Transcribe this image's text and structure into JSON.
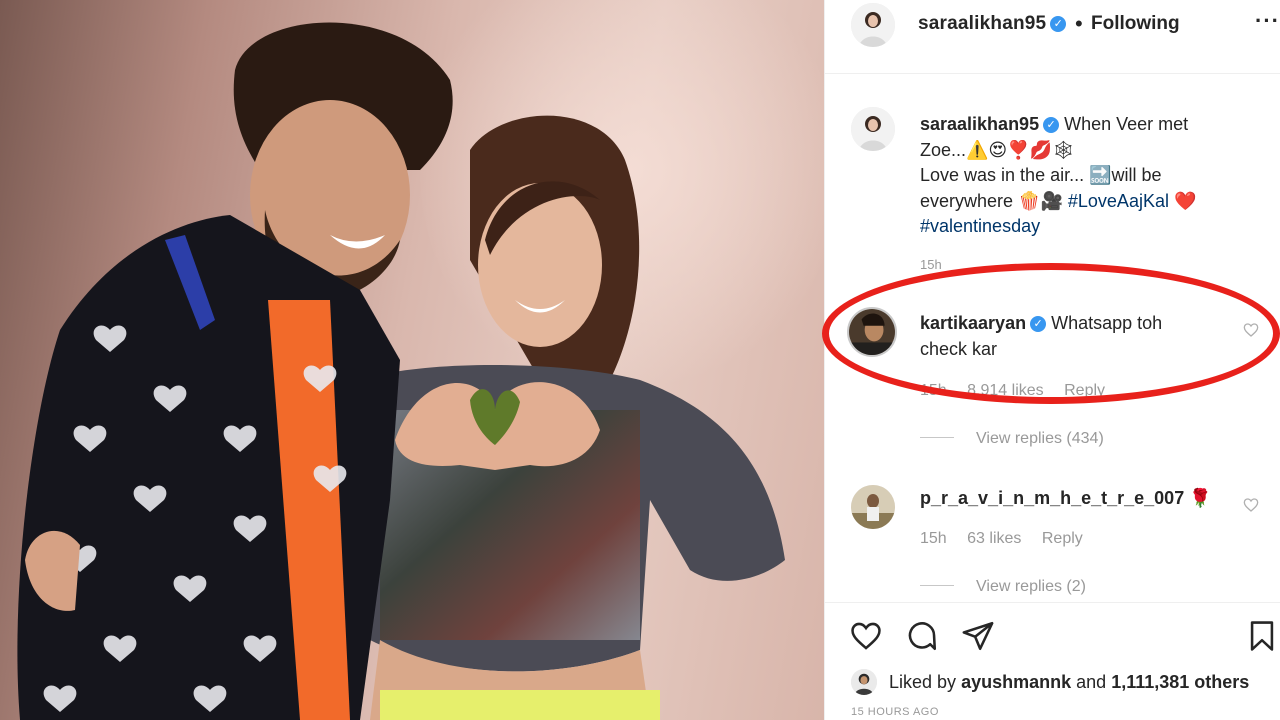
{
  "post": {
    "username": "saraalikhan95",
    "dot": "•",
    "follow_status": "Following",
    "more_icon": "more-options-icon"
  },
  "caption": {
    "username": "saraalikhan95",
    "line1": "When Veer met",
    "line2": "Zoe...⚠️😍❣️💋🕸",
    "line3": "Love was in the air... 🔜will be",
    "line4": "everywhere 🍿🎥",
    "hashtag1": "#LoveAajKal",
    "heart": "❤️",
    "hashtag2": "#valentinesday",
    "time": "15h"
  },
  "comments": [
    {
      "username": "kartikaaryan",
      "text_line1": "Whatsapp toh",
      "text_line2": "check kar",
      "time": "15h",
      "likes": "8,914 likes",
      "reply": "Reply",
      "view_replies": "View replies (434)"
    },
    {
      "username": "p_r_a_v_i_n_m_h_e_t_r_e_007",
      "username_display": "p_r_a_v_i_n_m_h_e_t_r_e_007",
      "emoji": "🌹",
      "time": "15h",
      "likes": "63 likes",
      "reply": "Reply",
      "view_replies": "View replies (2)"
    }
  ],
  "actions": {
    "like_icon": "heart-icon",
    "comment_icon": "comment-icon",
    "share_icon": "share-icon",
    "save_icon": "bookmark-icon"
  },
  "liked_by": {
    "prefix": "Liked by",
    "user": "ayushmannk",
    "joiner": "and",
    "count": "1,111,381 others"
  },
  "timestamp": "15 HOURS AGO",
  "colors": {
    "verified": "#3897f0",
    "highlight": "#e8211b",
    "hashtag": "#003569",
    "muted": "#999999"
  }
}
